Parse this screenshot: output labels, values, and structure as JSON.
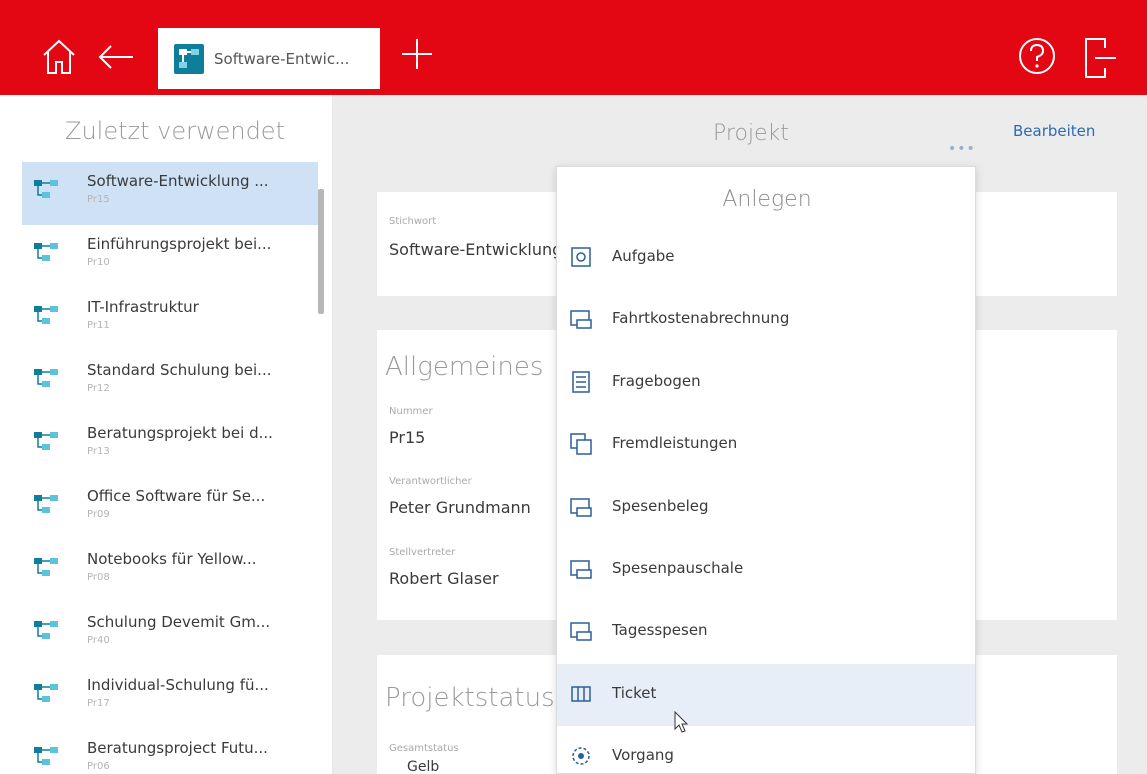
{
  "topbar": {
    "tab_label": "Software-Entwic..."
  },
  "sidebar": {
    "title": "Zuletzt verwendet",
    "items": [
      {
        "title": "Software-Entwicklung ...",
        "sub": "Pr15"
      },
      {
        "title": "Einführungsprojekt bei...",
        "sub": "Pr10"
      },
      {
        "title": "IT-Infrastruktur",
        "sub": "Pr11"
      },
      {
        "title": "Standard Schulung bei...",
        "sub": "Pr12"
      },
      {
        "title": "Beratungsprojekt bei d...",
        "sub": "Pr13"
      },
      {
        "title": "Office Software für Se...",
        "sub": "Pr09"
      },
      {
        "title": "Notebooks für Yellow...",
        "sub": "Pr08"
      },
      {
        "title": "Schulung Devemit Gm...",
        "sub": "Pr40"
      },
      {
        "title": "Individual-Schulung fü...",
        "sub": "Pr17"
      },
      {
        "title": "Beratungsproject Futu...",
        "sub": "Pr06"
      }
    ]
  },
  "main": {
    "title": "Projekt",
    "more": "•••",
    "edit_label": "Bearbeiten",
    "name_label": "Stichwort",
    "name_value": "Software-Entwicklung",
    "general_heading": "Allgemeines",
    "number_label": "Nummer",
    "number_value": "Pr15",
    "manager_label": "Verantwortlicher",
    "manager_value": "Peter Grundmann",
    "deputy_label": "Stellvertreter",
    "deputy_value": "Robert Glaser",
    "status_heading": "Projektstatus",
    "status_label": "Gesamtstatus",
    "status_value": "Gelb"
  },
  "create_menu": {
    "title": "Anlegen",
    "items": [
      {
        "label": "Aufgabe",
        "icon": "task-icon"
      },
      {
        "label": "Fahrtkostenabrechnung",
        "icon": "travel-expense-icon"
      },
      {
        "label": "Fragebogen",
        "icon": "questionnaire-icon"
      },
      {
        "label": "Fremdleistungen",
        "icon": "external-services-icon"
      },
      {
        "label": "Spesenbeleg",
        "icon": "expense-receipt-icon"
      },
      {
        "label": "Spesenpauschale",
        "icon": "expense-flat-rate-icon"
      },
      {
        "label": "Tagesspesen",
        "icon": "daily-allowance-icon"
      },
      {
        "label": "Ticket",
        "icon": "ticket-icon"
      },
      {
        "label": "Vorgang",
        "icon": "process-icon"
      }
    ]
  },
  "colors": {
    "brand_red": "#e30613",
    "selection": "#cfe1f5",
    "link_blue": "#2a6bb5",
    "project_icon_teal": "#0e7e9b"
  }
}
